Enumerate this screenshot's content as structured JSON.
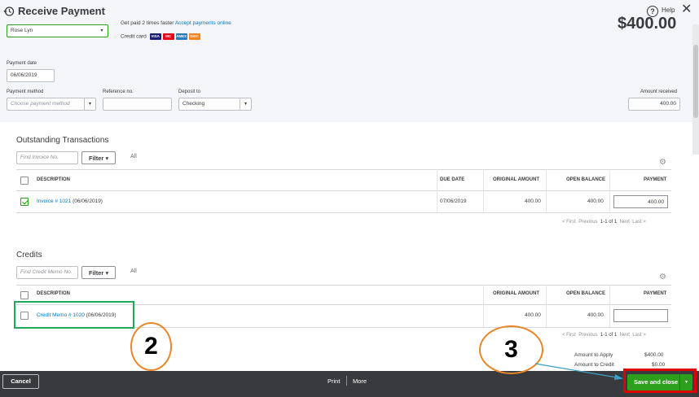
{
  "header": {
    "title": "Receive Payment",
    "help_label": "Help",
    "close_glyph": "✕"
  },
  "customer": {
    "value": "Rose Lyn",
    "getpaid_text": "Get paid 2 times faster",
    "getpaid_link": "Accept payments online",
    "credit_card_label": "Credit card",
    "cards": [
      "VISA",
      "MC",
      "AMEX",
      "DISC"
    ]
  },
  "amount_big": "$400.00",
  "payment_date": {
    "label": "Payment date",
    "value": "06/06/2019"
  },
  "payment_method": {
    "label": "Payment method",
    "placeholder": "Choose payment method"
  },
  "reference": {
    "label": "Reference no.",
    "value": ""
  },
  "deposit": {
    "label": "Deposit to",
    "value": "Checking"
  },
  "amount_received": {
    "label": "Amount received",
    "value": "400.00"
  },
  "outstanding": {
    "title": "Outstanding Transactions",
    "search_placeholder": "Find Invoice No.",
    "filter_label": "Filter",
    "all_label": "All",
    "columns": {
      "description": "DESCRIPTION",
      "due_date": "DUE DATE",
      "original_amount": "ORIGINAL AMOUNT",
      "open_balance": "OPEN BALANCE",
      "payment": "PAYMENT"
    },
    "rows": [
      {
        "link": "Invoice # 1021",
        "date": "(06/06/2019)",
        "due_date": "07/06/2019",
        "original_amount": "400.00",
        "open_balance": "400.00",
        "payment": "400.00",
        "checked": true
      }
    ],
    "pager": {
      "first": "< First",
      "previous": "Previous",
      "range": "1-1 of 1",
      "next": "Next",
      "last": "Last >"
    }
  },
  "credits": {
    "title": "Credits",
    "search_placeholder": "Find Credit Memo No.",
    "filter_label": "Filter",
    "all_label": "All",
    "columns": {
      "description": "DESCRIPTION",
      "original_amount": "ORIGINAL AMOUNT",
      "open_balance": "OPEN BALANCE",
      "payment": "PAYMENT"
    },
    "rows": [
      {
        "link": "Credit Memo # 1020",
        "date": "(06/06/2019)",
        "original_amount": "400.00",
        "open_balance": "400.00",
        "payment": "",
        "checked": false
      }
    ],
    "pager": {
      "first": "< First",
      "previous": "Previous",
      "range": "1-1 of 1",
      "next": "Next",
      "last": "Last >"
    }
  },
  "summary": {
    "amount_to_apply_label": "Amount to Apply",
    "amount_to_apply": "$400.00",
    "amount_to_credit_label": "Amount to Credit",
    "amount_to_credit": "$0.00"
  },
  "footer": {
    "cancel_label": "Cancel",
    "print_label": "Print",
    "more_label": "More",
    "save_label": "Save and close"
  },
  "annotations": {
    "step_2": "2",
    "step_3": "3",
    "colors": {
      "circle": "#e8862a",
      "green_box": "#22a85a",
      "red_box": "#e00000",
      "arrow": "#3aa0c8"
    }
  }
}
